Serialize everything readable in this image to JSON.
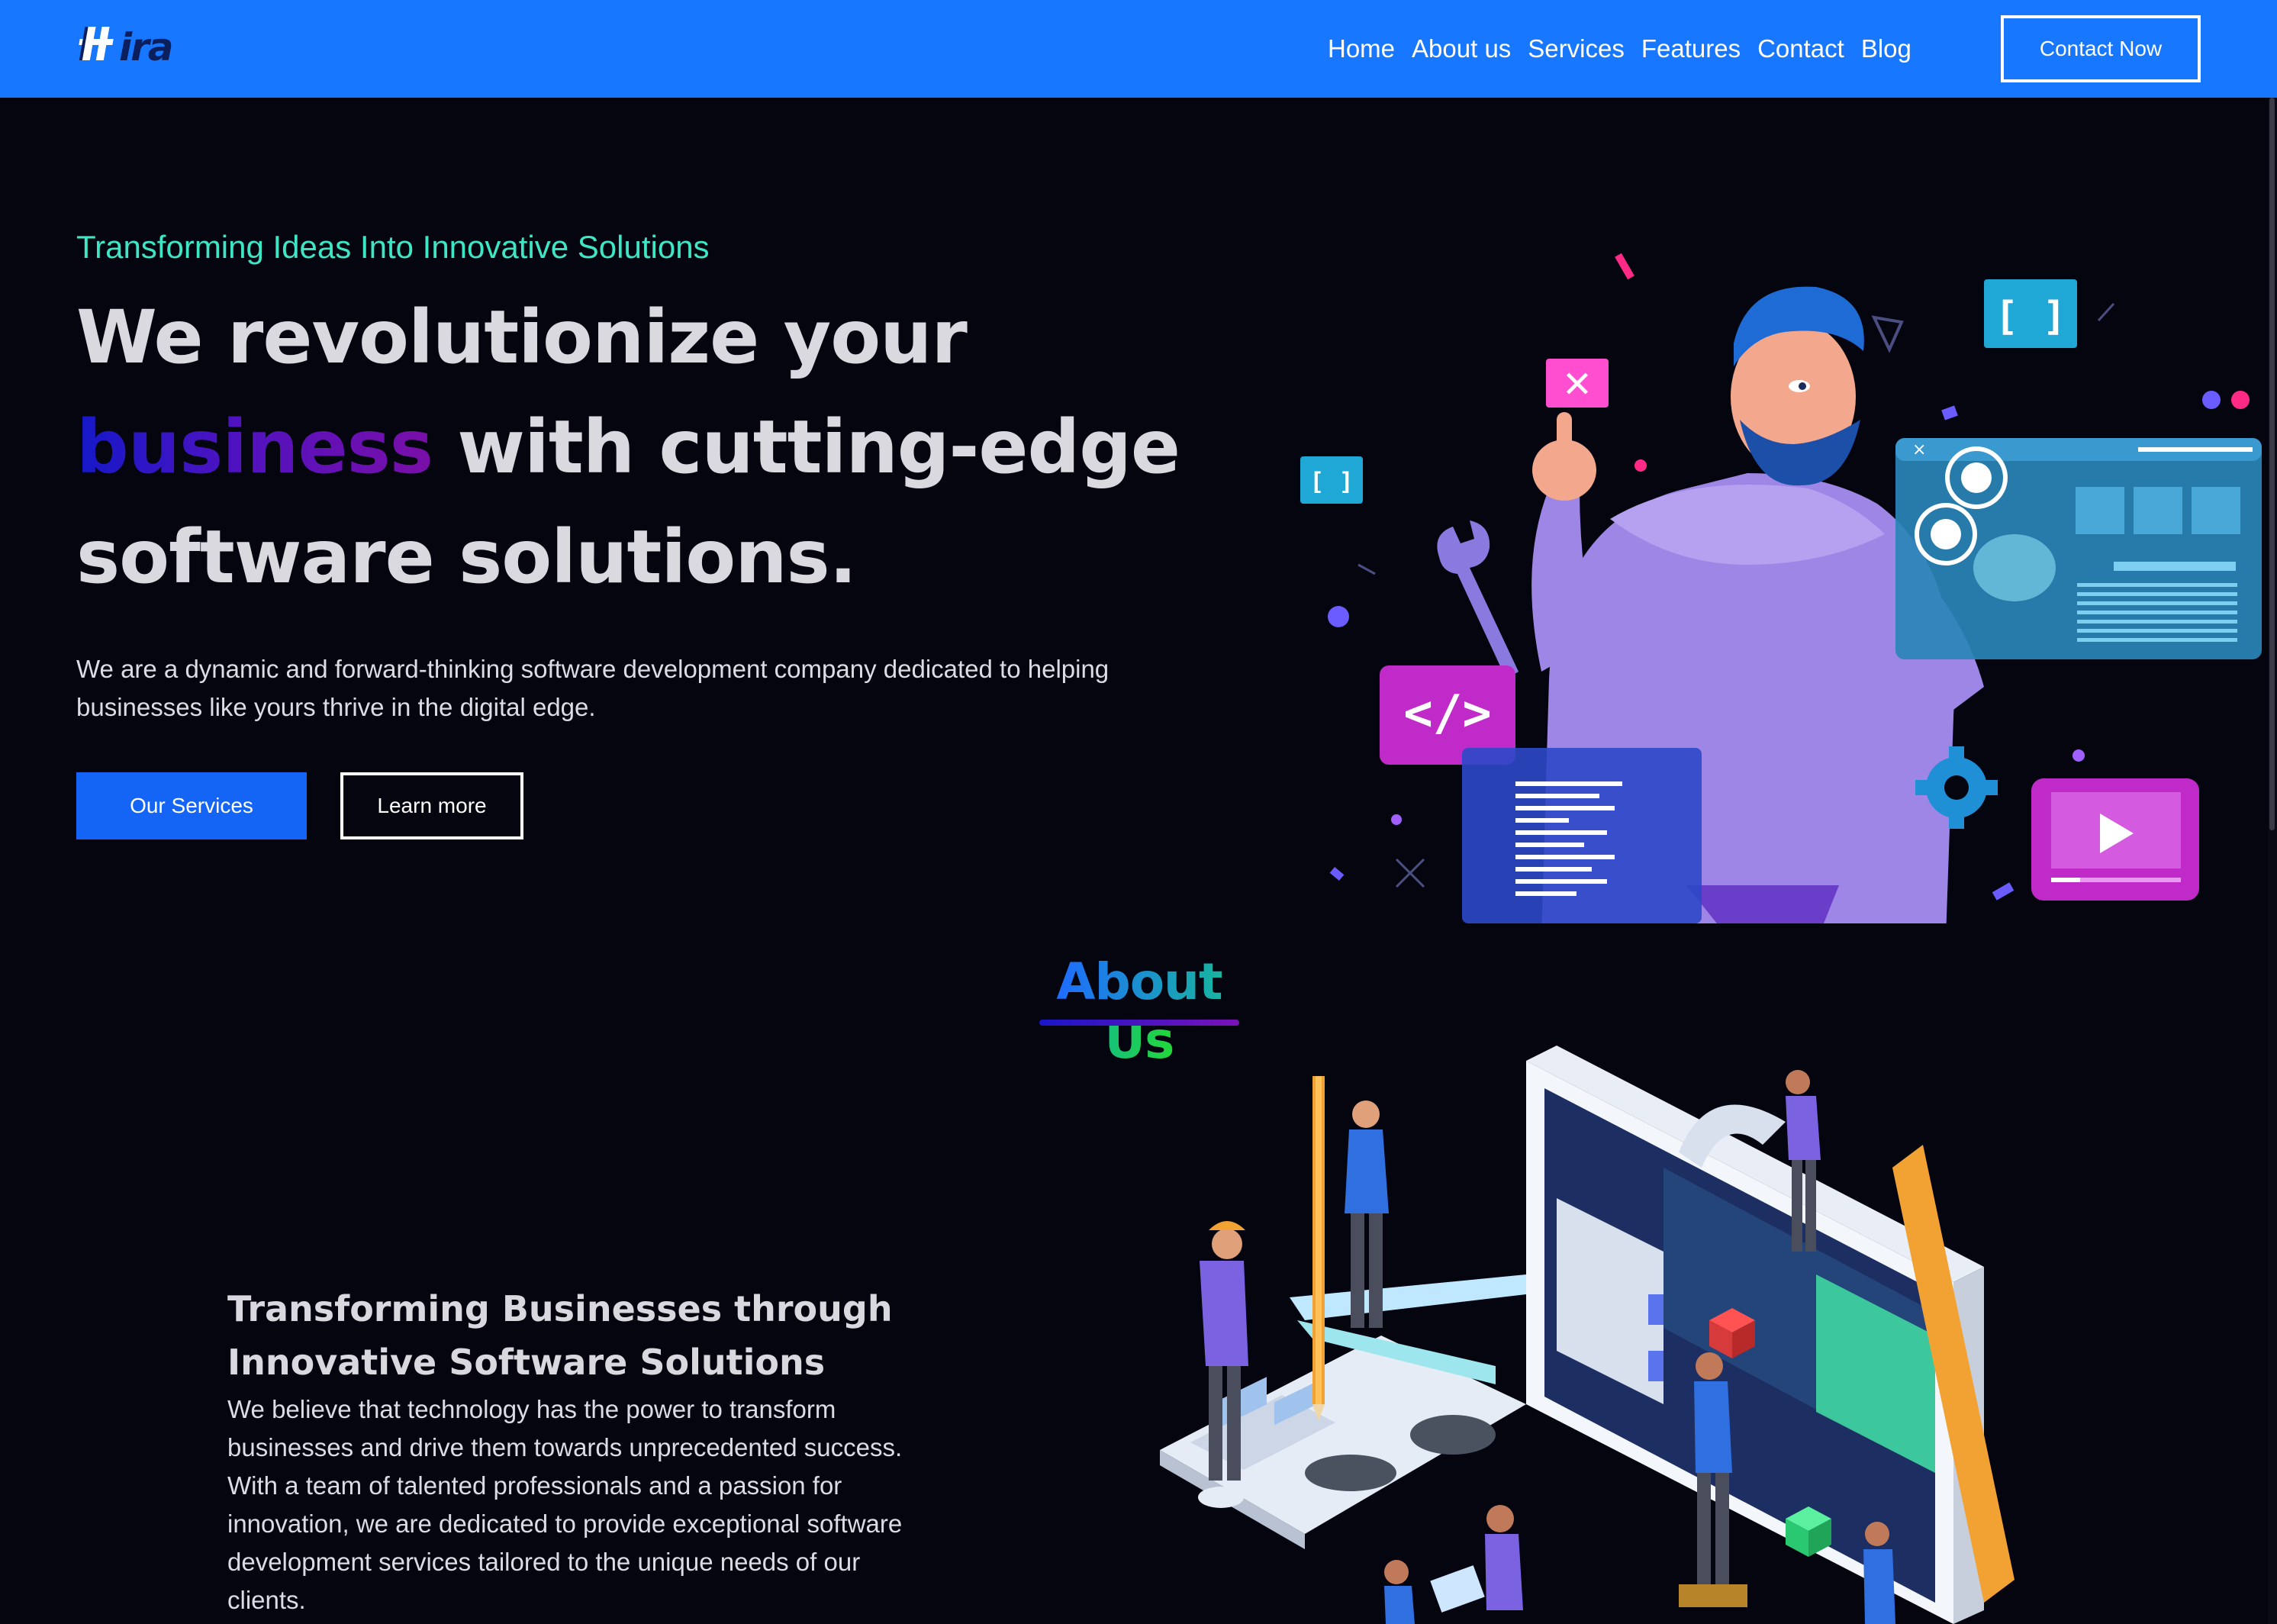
{
  "brand": {
    "logo_text": "Hira"
  },
  "nav": {
    "links": [
      "Home",
      "About us",
      "Services",
      "Features",
      "Contact",
      "Blog"
    ],
    "cta_label": "Contact Now"
  },
  "hero": {
    "tagline": "Transforming Ideas Into Innovative Solutions",
    "heading_line1": "We revolutionize your",
    "heading_accent": "business",
    "heading_line2_rest": " with cutting-edge",
    "heading_line3": "software solutions.",
    "description": "We are a dynamic and forward-thinking software development company dedicated to helping businesses like yours thrive in the digital edge.",
    "primary_button": "Our Services",
    "secondary_button": "Learn more"
  },
  "about": {
    "title_word1": "About",
    "title_word2": "Us",
    "subheading": "Transforming Businesses through Innovative Software Solutions",
    "body": "We believe that technology has the power to transform businesses and drive them towards unprecedented success. With a team of talented professionals and a passion for innovation, we are dedicated to provide exceptional software development services tailored to the unique needs of our clients."
  },
  "colors": {
    "navbar": "#1877ff",
    "background": "#05050f",
    "tagline": "#3ee6c5",
    "primary_button": "#1464f5"
  }
}
